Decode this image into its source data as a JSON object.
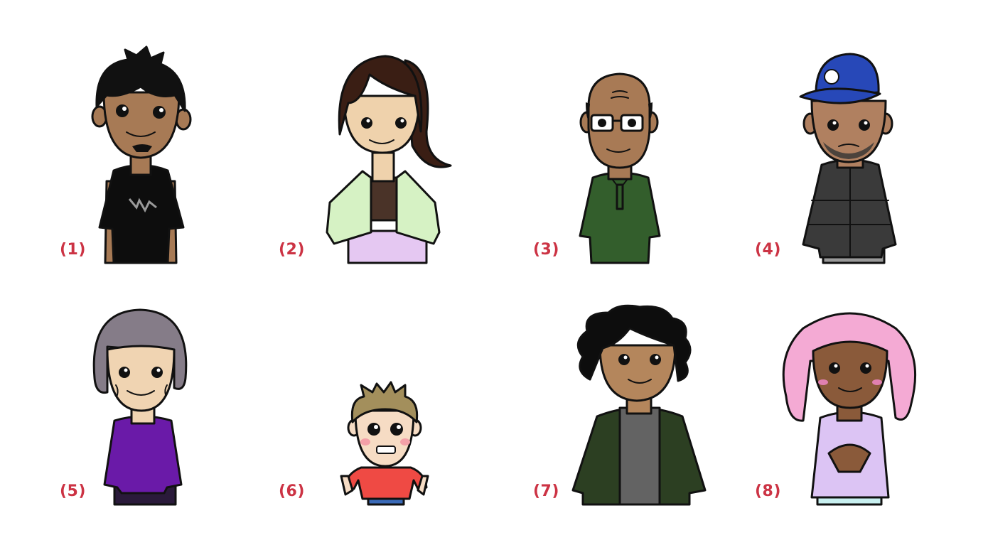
{
  "characters": [
    {
      "label": "(1)",
      "skin": "#a77a55",
      "hair": "#111111",
      "shirt": "#0d0d0d"
    },
    {
      "label": "(2)",
      "skin": "#efd2ac",
      "hair": "#3a1e14",
      "jacket": "#d6f2c4",
      "skirt": "#e5c8f2"
    },
    {
      "label": "(3)",
      "skin": "#a87a55",
      "shirt": "#335e2c"
    },
    {
      "label": "(4)",
      "skin": "#b08060",
      "cap": "#2748b8",
      "jacket": "#3a3a3a"
    },
    {
      "label": "(5)",
      "skin": "#f0d4b2",
      "hair": "#857c88",
      "top": "#6a1aa8"
    },
    {
      "label": "(6)",
      "skin": "#f6dcc4",
      "hair": "#a38f5c",
      "shirt": "#ef4a44"
    },
    {
      "label": "(7)",
      "skin": "#b4865c",
      "hair": "#0d0d0d",
      "jacket": "#2c3f22",
      "tee": "#636363"
    },
    {
      "label": "(8)",
      "skin": "#8a5a3a",
      "hair": "#f4aad4",
      "hoodie": "#dcc4f4"
    }
  ]
}
